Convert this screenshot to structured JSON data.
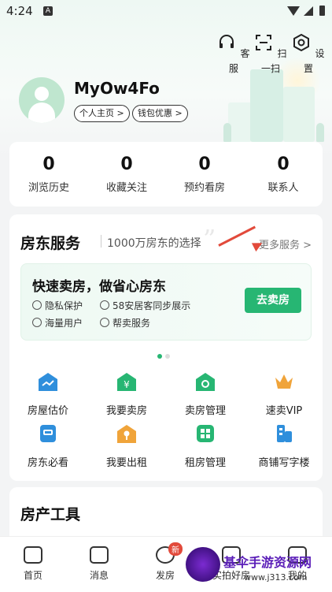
{
  "status": {
    "time": "4:24",
    "notif_label": "A"
  },
  "top_actions": [
    {
      "label": "客服",
      "icon": "headset-icon"
    },
    {
      "label": "扫一扫",
      "icon": "scan-icon"
    },
    {
      "label": "设置",
      "icon": "settings-icon"
    }
  ],
  "profile": {
    "username": "MyOw4Fo",
    "home_link": "个人主页 >",
    "wallet_link": "钱包优惠 >"
  },
  "stats": [
    {
      "value": "0",
      "label": "浏览历史"
    },
    {
      "value": "0",
      "label": "收藏关注"
    },
    {
      "value": "0",
      "label": "预约看房"
    },
    {
      "value": "0",
      "label": "联系人"
    }
  ],
  "landlord": {
    "title": "房东服务",
    "subtitle": "1000万房东的选择",
    "more": "更多服务 >",
    "promo": {
      "title": "快速卖房，做省心房东",
      "features": [
        "隐私保护",
        "58安居客同步展示",
        "海量用户",
        "帮卖服务"
      ],
      "button": "去卖房"
    },
    "services": [
      {
        "label": "房屋估价",
        "icon": "trend-house-icon"
      },
      {
        "label": "我要卖房",
        "icon": "yuan-house-icon"
      },
      {
        "label": "卖房管理",
        "icon": "manage-house-icon"
      },
      {
        "label": "速卖VIP",
        "icon": "crown-icon"
      },
      {
        "label": "房东必看",
        "icon": "guide-icon"
      },
      {
        "label": "我要出租",
        "icon": "key-icon"
      },
      {
        "label": "租房管理",
        "icon": "grid-icon"
      },
      {
        "label": "商铺写字楼",
        "icon": "office-icon"
      }
    ]
  },
  "tools": {
    "title": "房产工具"
  },
  "tabbar": [
    {
      "label": "首页",
      "icon": "home-icon"
    },
    {
      "label": "消息",
      "icon": "message-icon"
    },
    {
      "label": "发房",
      "icon": "post-icon",
      "badge": "新"
    },
    {
      "label": "实拍好房",
      "icon": "camera-icon"
    },
    {
      "label": "我的",
      "icon": "profile-icon"
    }
  ],
  "watermark": {
    "name": "基伞手游资源网",
    "url": "www.j313.com"
  },
  "colors": {
    "accent": "#27b673",
    "arrow": "#e24a3b"
  }
}
